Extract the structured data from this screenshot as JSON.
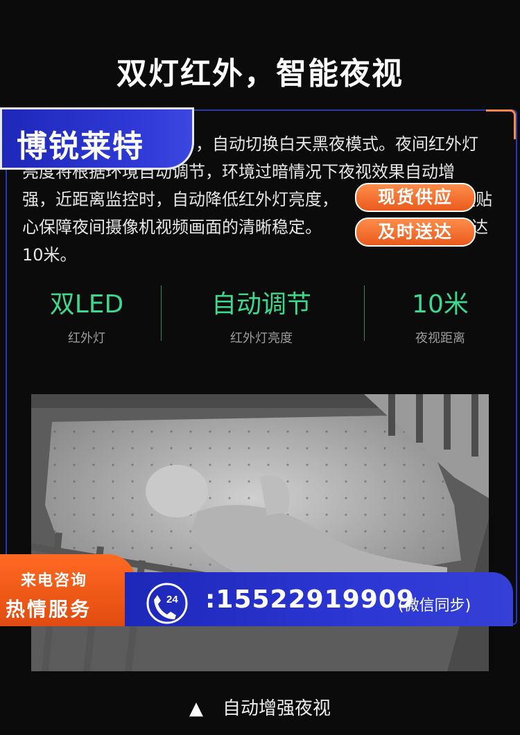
{
  "title": "双灯红外，智能夜视",
  "brand": "博锐莱特",
  "description": {
    "lines": [
      "，自动切换白天黑夜模式。夜间红外灯",
      "亮度将根据环境自动调节，环境过暗情况下夜视效果自动增",
      "强，近距离监控时，自动降低红外灯亮度，",
      "心保障夜间摄像机视频画面的清晰稳定。",
      "10米。"
    ],
    "tail_1": "更贴",
    "tail_2": "可达"
  },
  "tags": {
    "tag1": "现货供应",
    "tag2": "及时送达"
  },
  "stats": [
    {
      "value": "双LED",
      "label": "红外灯"
    },
    {
      "value": "自动调节",
      "label": "红外灯亮度"
    },
    {
      "value": "10米",
      "label": "夜视距离"
    }
  ],
  "caption": {
    "icon": "up-triangle",
    "text": "自动增强夜视"
  },
  "hotline": {
    "line1": "来电咨询",
    "line2": "热情服务",
    "icon": "phone-24h-icon",
    "icon_text": "24",
    "number": ":15522919909",
    "note": "(微信同步)"
  },
  "colors": {
    "accent_green": "#3bd88f",
    "brand_blue": "#2f3ad6",
    "orange": "#ea5a1c"
  }
}
